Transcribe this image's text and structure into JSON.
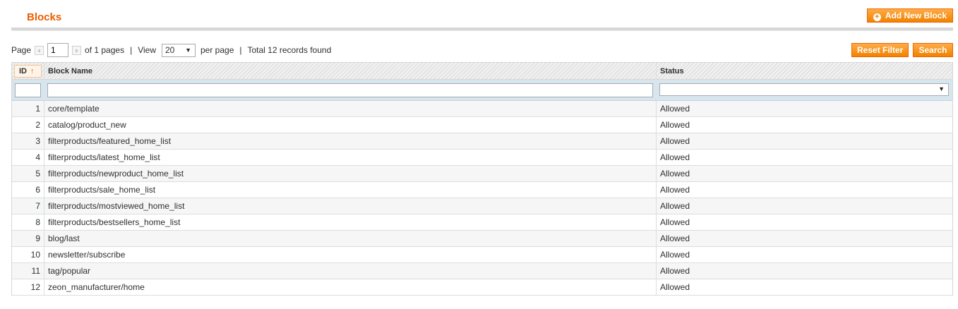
{
  "header": {
    "title": "Blocks",
    "add_button_label": "Add New Block"
  },
  "pager": {
    "page_label": "Page",
    "page_value": "1",
    "of_pages": "of 1 pages",
    "view_label": "View",
    "per_page_value": "20",
    "per_page_label": "per page",
    "total_text": "Total 12 records found"
  },
  "actions": {
    "reset_label": "Reset Filter",
    "search_label": "Search"
  },
  "grid": {
    "columns": {
      "id": "ID",
      "name": "Block Name",
      "status": "Status"
    },
    "sort_indicator": "↑",
    "rows": [
      {
        "id": "1",
        "name": "core/template",
        "status": "Allowed"
      },
      {
        "id": "2",
        "name": "catalog/product_new",
        "status": "Allowed"
      },
      {
        "id": "3",
        "name": "filterproducts/featured_home_list",
        "status": "Allowed"
      },
      {
        "id": "4",
        "name": "filterproducts/latest_home_list",
        "status": "Allowed"
      },
      {
        "id": "5",
        "name": "filterproducts/newproduct_home_list",
        "status": "Allowed"
      },
      {
        "id": "6",
        "name": "filterproducts/sale_home_list",
        "status": "Allowed"
      },
      {
        "id": "7",
        "name": "filterproducts/mostviewed_home_list",
        "status": "Allowed"
      },
      {
        "id": "8",
        "name": "filterproducts/bestsellers_home_list",
        "status": "Allowed"
      },
      {
        "id": "9",
        "name": "blog/last",
        "status": "Allowed"
      },
      {
        "id": "10",
        "name": "newsletter/subscribe",
        "status": "Allowed"
      },
      {
        "id": "11",
        "name": "tag/popular",
        "status": "Allowed"
      },
      {
        "id": "12",
        "name": "zeon_manufacturer/home",
        "status": "Allowed"
      }
    ]
  },
  "colors": {
    "accent": "#eb5e00",
    "button": "#f18200",
    "filter_bg": "#d7e5ef"
  }
}
